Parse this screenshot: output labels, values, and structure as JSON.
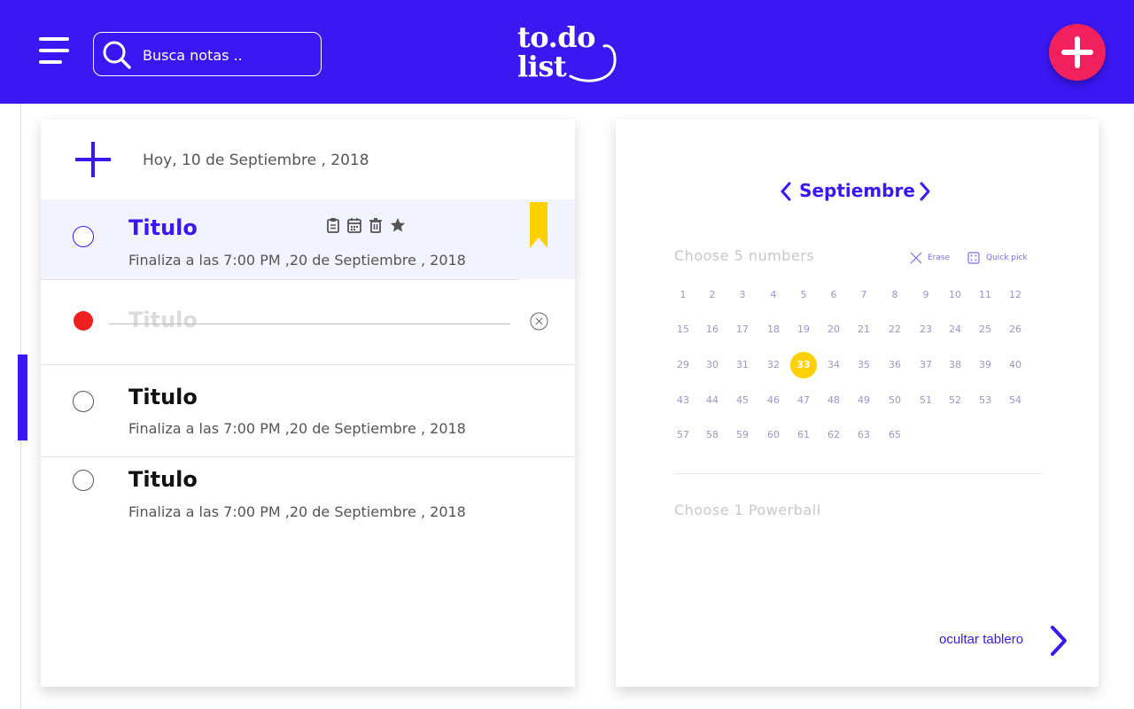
{
  "header": {
    "search_placeholder": "Busca notas ..",
    "logo_line1": "to.do",
    "logo_line2": "list",
    "brand_color": "#3a17f3",
    "fab_color": "#f2215d"
  },
  "tasks_panel": {
    "today_label": "Hoy, 10 de Septiembre , 2018",
    "tasks": [
      {
        "title": "Titulo",
        "subtitle": "Finaliza a las 7:00 PM ,20 de Septiembre , 2018",
        "state": "selected",
        "bookmarked": true
      },
      {
        "title": "Titulo",
        "subtitle": "",
        "state": "completed"
      },
      {
        "title": "Titulo",
        "subtitle": "Finaliza a las 7:00 PM ,20 de Septiembre , 2018",
        "state": "pending"
      },
      {
        "title": "Titulo",
        "subtitle": "Finaliza a las 7:00 PM ,20 de Septiembre , 2018",
        "state": "pending"
      }
    ],
    "task_actions": [
      "clipboard-icon",
      "calendar-icon",
      "trash-icon",
      "star-icon"
    ]
  },
  "board": {
    "month": "Septiembre",
    "choose_numbers_label": "Choose 5 numbers",
    "erase_label": "Erase",
    "quick_pick_label": "Quick pick",
    "numbers": [
      [
        "1",
        "2",
        "3",
        "4",
        "5",
        "6",
        "7",
        "8",
        "9",
        "10",
        "11",
        "12"
      ],
      [
        "15",
        "16",
        "17",
        "18",
        "19",
        "20",
        "21",
        "22",
        "23",
        "24",
        "25",
        "26"
      ],
      [
        "29",
        "30",
        "31",
        "32",
        "33",
        "34",
        "35",
        "36",
        "37",
        "38",
        "39",
        "40"
      ],
      [
        "43",
        "44",
        "45",
        "46",
        "47",
        "48",
        "49",
        "50",
        "51",
        "52",
        "53",
        "54"
      ],
      [
        "57",
        "58",
        "59",
        "60",
        "61",
        "62",
        "63",
        "65"
      ]
    ],
    "selected_number": "33",
    "selected_color": "#ffd000",
    "powerball_label": "Choose 1 Powerball",
    "hide_board_label": "ocultar tablero"
  }
}
